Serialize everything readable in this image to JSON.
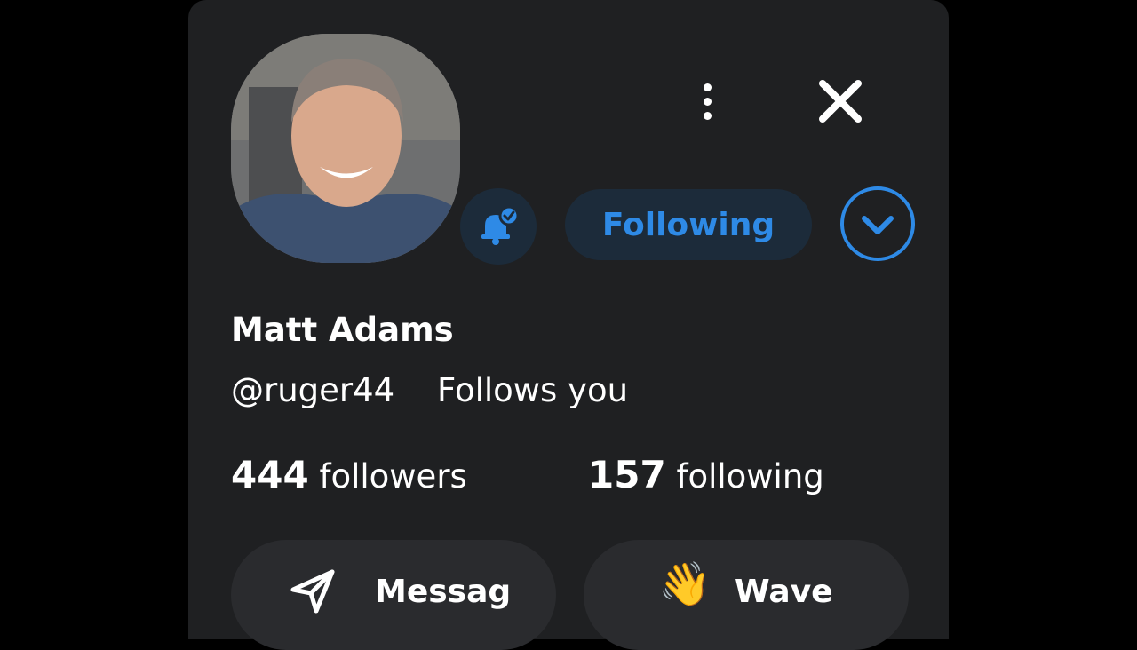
{
  "profile": {
    "name": "Matt Adams",
    "handle": "@ruger44",
    "follows_you": "Follows you"
  },
  "header": {
    "following_label": "Following"
  },
  "stats": {
    "followers_count": "444",
    "followers_label": "followers",
    "following_count": "157",
    "following_label": "following"
  },
  "actions": {
    "message_label": "Messag",
    "wave_label": "Wave",
    "wave_emoji": "👋"
  },
  "icons": {
    "more": "more-vertical-icon",
    "close": "close-icon",
    "bell": "bell-check-icon",
    "chevron": "chevron-down-icon",
    "send": "send-icon"
  },
  "colors": {
    "accent": "#2e8ae6",
    "accent_bg": "#1c2b3a",
    "panel_bg": "#1f2022",
    "button_bg": "#2a2b2e"
  }
}
